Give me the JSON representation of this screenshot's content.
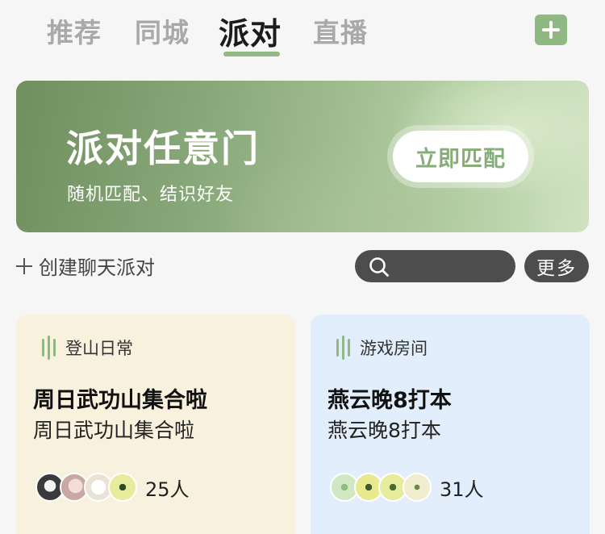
{
  "tabs": [
    {
      "label": "推荐",
      "active": false
    },
    {
      "label": "同城",
      "active": false
    },
    {
      "label": "派对",
      "active": true
    },
    {
      "label": "直播",
      "active": false
    }
  ],
  "header": {
    "add_icon": "plus-icon"
  },
  "banner": {
    "title": "派对任意门",
    "subtitle": "随机匹配、结识好友",
    "button_label": "立即匹配"
  },
  "actions": {
    "create_label": "创建聊天派对",
    "search_placeholder": "",
    "more_label": "更多"
  },
  "cards": [
    {
      "tag": "登山日常",
      "title": "周日武功山集合啦",
      "subtitle": "周日武功山集合啦",
      "count": "25人",
      "avatar_colors": [
        "#3a3a3a",
        "#e8c9c5",
        "#e9e3d6",
        "#e6ec9b"
      ]
    },
    {
      "tag": "游戏房间",
      "title": "燕云晚8打本",
      "subtitle": "燕云晚8打本",
      "count": "31人",
      "avatar_colors": [
        "#cfe7c2",
        "#e9ea8e",
        "#e5ec9c",
        "#f1edcf"
      ]
    }
  ],
  "colors": {
    "accent": "#8fb883",
    "banner_button_text": "#86ad78",
    "card_left_bg": "#f8f1de",
    "card_right_bg": "#e2eefb",
    "dark_pill": "#4d4d4d"
  }
}
